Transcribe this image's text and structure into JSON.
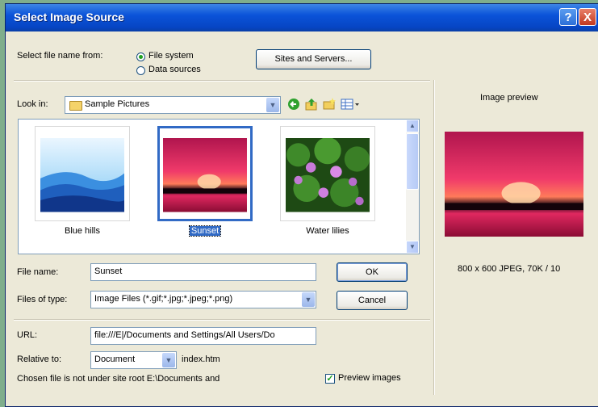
{
  "window": {
    "title": "Select Image Source",
    "help_glyph": "?",
    "close_glyph": "X"
  },
  "source": {
    "label": "Select file name from:",
    "options": [
      "File system",
      "Data sources"
    ],
    "selected_index": 0,
    "sites_button": "Sites and Servers..."
  },
  "lookin": {
    "label": "Look in:",
    "folder": "Sample Pictures",
    "icons": [
      "back-icon",
      "up-folder-icon",
      "new-folder-icon",
      "view-menu-icon"
    ]
  },
  "files": [
    {
      "name": "Blue hills",
      "selected": false
    },
    {
      "name": "Sunset",
      "selected": true
    },
    {
      "name": "Water lilies",
      "selected": false
    }
  ],
  "file_name": {
    "label": "File name:",
    "value": "Sunset"
  },
  "file_type": {
    "label": "Files of type:",
    "value": "Image Files (*.gif;*.jpg;*.jpeg;*.png)"
  },
  "buttons": {
    "ok": "OK",
    "cancel": "Cancel"
  },
  "url": {
    "label": "URL:",
    "value": "file:///E|/Documents and Settings/All Users/Do"
  },
  "relative": {
    "label": "Relative to:",
    "value": "Document",
    "file": "index.htm"
  },
  "note": "Chosen file is not under site root E:\\Documents and",
  "preview": {
    "heading": "Image preview",
    "info": "800 x 600 JPEG, 70K / 10",
    "checkbox_label": "Preview images",
    "checked": true
  },
  "colors": {
    "title_bar": "#0b53d9",
    "dialog": "#ece9d8",
    "selection": "#316ac5"
  }
}
